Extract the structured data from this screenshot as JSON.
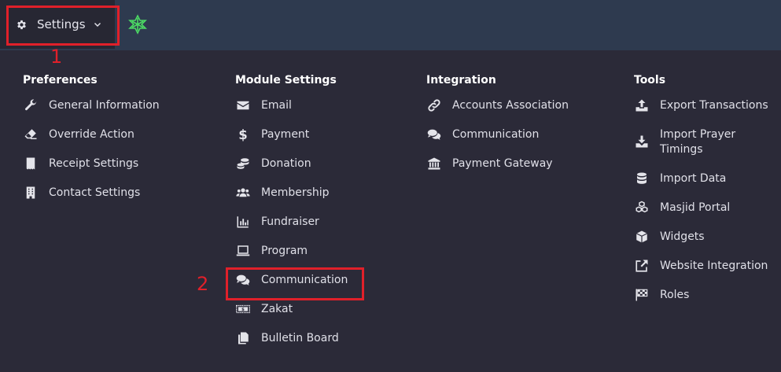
{
  "topbar": {
    "settings_label": "Settings",
    "colors": {
      "bar": "#2e3a4f",
      "settings_bg": "#272733",
      "accent_icon": "#4cd964"
    }
  },
  "annotations": {
    "step1": "1",
    "step2": "2",
    "color": "#e0202a"
  },
  "columns": [
    {
      "title": "Preferences",
      "items": [
        {
          "label": "General Information",
          "icon": "wrench-icon"
        },
        {
          "label": "Override Action",
          "icon": "eraser-icon"
        },
        {
          "label": "Receipt Settings",
          "icon": "receipt-icon"
        },
        {
          "label": "Contact Settings",
          "icon": "building-icon"
        }
      ]
    },
    {
      "title": "Module Settings",
      "items": [
        {
          "label": "Email",
          "icon": "envelope-icon"
        },
        {
          "label": "Payment",
          "icon": "dollar-icon"
        },
        {
          "label": "Donation",
          "icon": "coins-icon"
        },
        {
          "label": "Membership",
          "icon": "users-icon"
        },
        {
          "label": "Fundraiser",
          "icon": "chart-bar-icon"
        },
        {
          "label": "Program",
          "icon": "laptop-icon"
        },
        {
          "label": "Communication",
          "icon": "comments-icon"
        },
        {
          "label": "Zakat",
          "icon": "money-bill-icon"
        },
        {
          "label": "Bulletin Board",
          "icon": "copy-icon"
        }
      ]
    },
    {
      "title": "Integration",
      "items": [
        {
          "label": "Accounts Association",
          "icon": "link-icon"
        },
        {
          "label": "Communication",
          "icon": "comments-icon"
        },
        {
          "label": "Payment Gateway",
          "icon": "bank-icon"
        }
      ]
    },
    {
      "title": "Tools",
      "items": [
        {
          "label": "Export Transactions",
          "icon": "upload-icon"
        },
        {
          "label": "Import Prayer Timings",
          "icon": "download-icon"
        },
        {
          "label": "Import Data",
          "icon": "database-icon"
        },
        {
          "label": "Masjid Portal",
          "icon": "cubes-icon"
        },
        {
          "label": "Widgets",
          "icon": "cube-icon"
        },
        {
          "label": "Website Integration",
          "icon": "external-link-icon"
        },
        {
          "label": "Roles",
          "icon": "flag-checkered-icon"
        }
      ]
    }
  ]
}
